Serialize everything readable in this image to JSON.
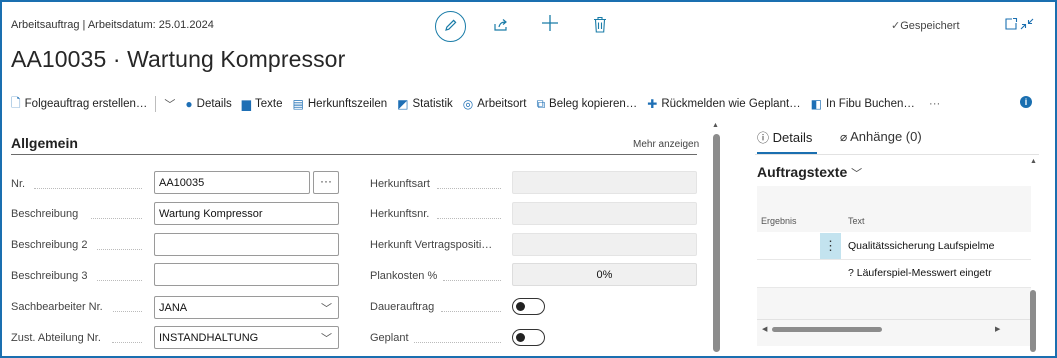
{
  "header": {
    "meta": "Arbeitsauftrag | Arbeitsdatum: 25.01.2024",
    "title": "AA10035 · Wartung Kompressor",
    "saved_status": "Gespeichert"
  },
  "toolbar": {
    "items": [
      {
        "label": "Folgeauftrag erstellen…",
        "icon": "document-arrow-icon"
      },
      {
        "label": "Details",
        "icon": "circle-details-icon"
      },
      {
        "label": "Texte",
        "icon": "flag-text-icon"
      },
      {
        "label": "Herkunftszeilen",
        "icon": "lines-icon"
      },
      {
        "label": "Statistik",
        "icon": "chart-icon"
      },
      {
        "label": "Arbeitsort",
        "icon": "globe-icon"
      },
      {
        "label": "Beleg kopieren…",
        "icon": "copy-icon"
      },
      {
        "label": "Rückmelden wie Geplant…",
        "icon": "report-back-icon"
      },
      {
        "label": "In Fibu Buchen…",
        "icon": "post-icon"
      }
    ],
    "more": "···"
  },
  "general": {
    "title": "Allgemein",
    "show_more": "Mehr anzeigen",
    "left_fields": [
      {
        "label": "Nr.",
        "value": "AA10035"
      },
      {
        "label": "Beschreibung",
        "value": "Wartung Kompressor"
      },
      {
        "label": "Beschreibung 2",
        "value": ""
      },
      {
        "label": "Beschreibung 3",
        "value": ""
      },
      {
        "label": "Sachbearbeiter Nr.",
        "value": "JANA"
      },
      {
        "label": "Zust. Abteilung Nr.",
        "value": "INSTANDHALTUNG"
      }
    ],
    "right_fields": [
      {
        "label": "Herkunftsart",
        "value": ""
      },
      {
        "label": "Herkunftsnr.",
        "value": ""
      },
      {
        "label": "Herkunft Vertragspositi…",
        "value": ""
      },
      {
        "label": "Plankosten %",
        "value": "0%"
      },
      {
        "label": "Dauerauftrag",
        "value": false
      },
      {
        "label": "Geplant",
        "value": false
      }
    ]
  },
  "factbox": {
    "tab_details": "Details",
    "tab_attachments": "Anhänge (0)",
    "section_title": "Auftragstexte",
    "columns": [
      "Ergebnis",
      "Text"
    ],
    "rows": [
      {
        "ergebnis": "",
        "text": "Qualitätssicherung Laufspielme"
      },
      {
        "ergebnis": "",
        "text": "? Läuferspiel-Messwert eingetr"
      }
    ]
  }
}
